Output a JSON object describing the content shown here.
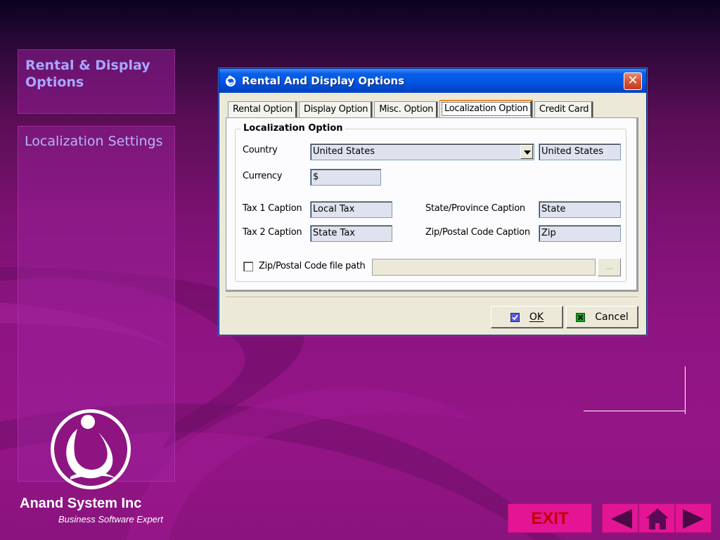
{
  "slide": {
    "title": "Rental & Display Options",
    "section": "Localization Settings",
    "company": "Anand System Inc",
    "tagline": "Business Software Expert"
  },
  "dialog": {
    "title": "Rental And Display Options",
    "close_icon": "close-icon",
    "tabs": [
      {
        "label": "Rental Option",
        "active": false
      },
      {
        "label": "Display Option",
        "active": false
      },
      {
        "label": "Misc. Option",
        "active": false
      },
      {
        "label": "Localization Option",
        "active": true
      },
      {
        "label": "Credit Card",
        "active": false
      }
    ],
    "group_title": "Localization Option",
    "country_label": "Country",
    "country_value": "United States",
    "country_display": "United States",
    "currency_label": "Currency",
    "currency_value": "$",
    "tax1_label": "Tax 1 Caption",
    "tax1_value": "Local Tax",
    "tax2_label": "Tax 2 Caption",
    "tax2_value": "State Tax",
    "state_label": "State/Province Caption",
    "state_value": "State",
    "zip_label": "Zip/Postal Code Caption",
    "zip_value": "Zip",
    "zipfile_label": "Zip/Postal Code file path",
    "zipfile_checked": false,
    "zipfile_value": "",
    "browse_label": "...",
    "ok_label": "OK",
    "cancel_label": "Cancel"
  },
  "nav": {
    "exit_label": "EXIT",
    "prev_icon": "prev-arrow-icon",
    "home_icon": "home-icon",
    "next_icon": "next-arrow-icon"
  },
  "colors": {
    "background": "#8e1482",
    "panel_text": "#a9a6ff",
    "nav_button": "#e31595",
    "exit_text": "#c40000",
    "dialog_titlebar": "#0055e5"
  }
}
